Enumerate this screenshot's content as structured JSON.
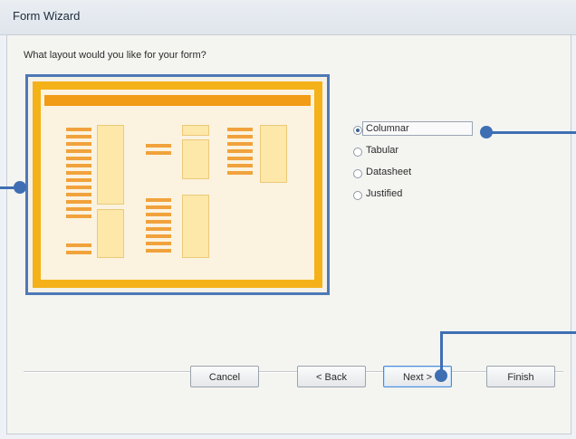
{
  "window": {
    "title": "Form Wizard"
  },
  "wizard": {
    "question": "What layout would you like for your form?",
    "layout_options": [
      {
        "label": "Columnar",
        "selected": true
      },
      {
        "label": "Tabular",
        "selected": false
      },
      {
        "label": "Datasheet",
        "selected": false
      },
      {
        "label": "Justified",
        "selected": false
      }
    ]
  },
  "buttons": {
    "cancel": "Cancel",
    "back": "< Back",
    "next": "Next >",
    "finish": "Finish"
  },
  "colors": {
    "accent": "#3f6fb3",
    "preview_frame": "#f4b118",
    "preview_bar": "#f1a23c"
  }
}
